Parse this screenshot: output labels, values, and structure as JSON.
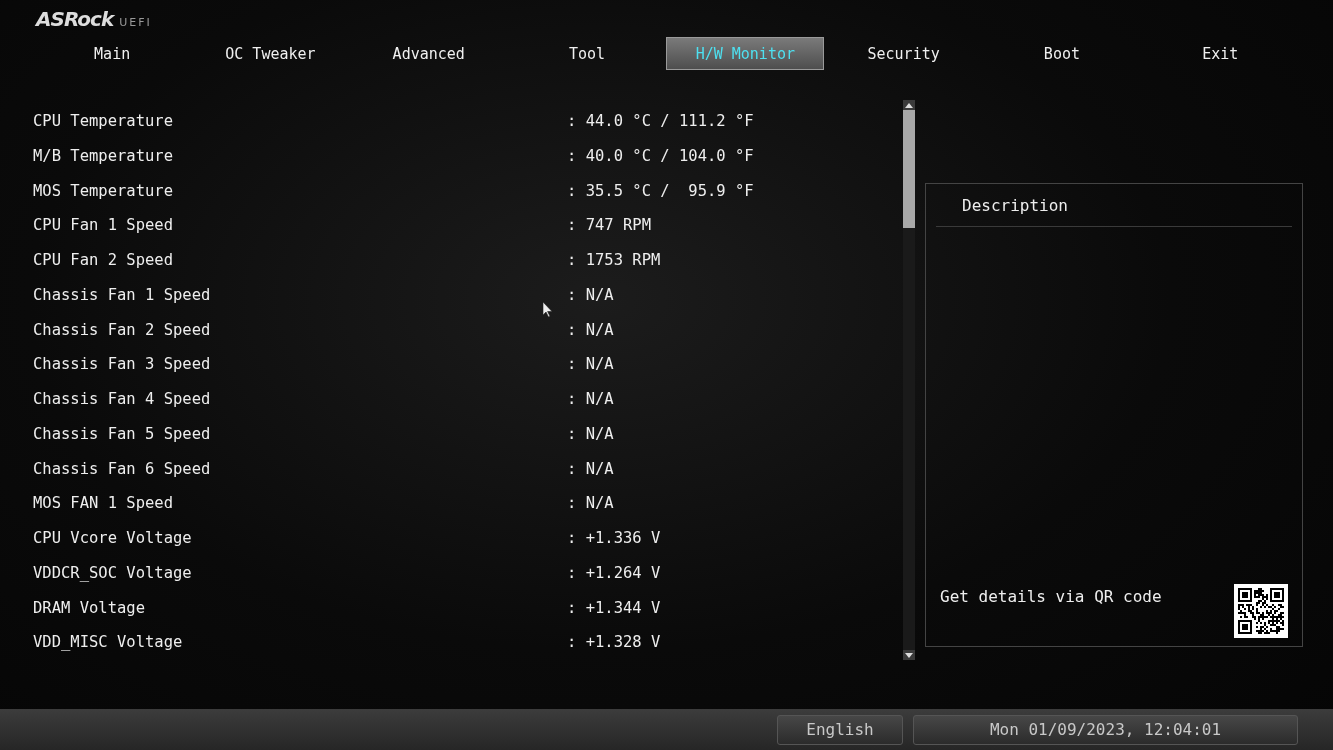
{
  "logo": {
    "brand": "ASRock",
    "suffix": "UEFI"
  },
  "tabs": [
    {
      "label": "Main",
      "selected": false
    },
    {
      "label": "OC Tweaker",
      "selected": false
    },
    {
      "label": "Advanced",
      "selected": false
    },
    {
      "label": "Tool",
      "selected": false
    },
    {
      "label": "H/W Monitor",
      "selected": true
    },
    {
      "label": "Security",
      "selected": false
    },
    {
      "label": "Boot",
      "selected": false
    },
    {
      "label": "Exit",
      "selected": false
    }
  ],
  "readings": [
    {
      "name": "CPU Temperature",
      "value": ": 44.0 °C / 111.2 °F"
    },
    {
      "name": "M/B Temperature",
      "value": ": 40.0 °C / 104.0 °F"
    },
    {
      "name": "MOS Temperature",
      "value": ": 35.5 °C /  95.9 °F"
    },
    {
      "name": "CPU Fan 1 Speed",
      "value": ": 747 RPM"
    },
    {
      "name": "CPU Fan 2 Speed",
      "value": ": 1753 RPM"
    },
    {
      "name": "Chassis Fan 1 Speed",
      "value": ": N/A"
    },
    {
      "name": "Chassis Fan 2 Speed",
      "value": ": N/A"
    },
    {
      "name": "Chassis Fan 3 Speed",
      "value": ": N/A"
    },
    {
      "name": "Chassis Fan 4 Speed",
      "value": ": N/A"
    },
    {
      "name": "Chassis Fan 5 Speed",
      "value": ": N/A"
    },
    {
      "name": "Chassis Fan 6 Speed",
      "value": ": N/A"
    },
    {
      "name": "MOS FAN 1 Speed",
      "value": ": N/A"
    },
    {
      "name": "CPU Vcore Voltage",
      "value": ": +1.336 V"
    },
    {
      "name": "VDDCR_SOC Voltage",
      "value": ": +1.264 V"
    },
    {
      "name": "DRAM Voltage",
      "value": ": +1.344 V"
    },
    {
      "name": "VDD_MISC Voltage",
      "value": ": +1.328 V"
    }
  ],
  "description": {
    "title": "Description",
    "qr_hint": "Get details via QR code"
  },
  "status_bar": {
    "language": "English",
    "datetime": "Mon 01/09/2023, 12:04:01"
  }
}
